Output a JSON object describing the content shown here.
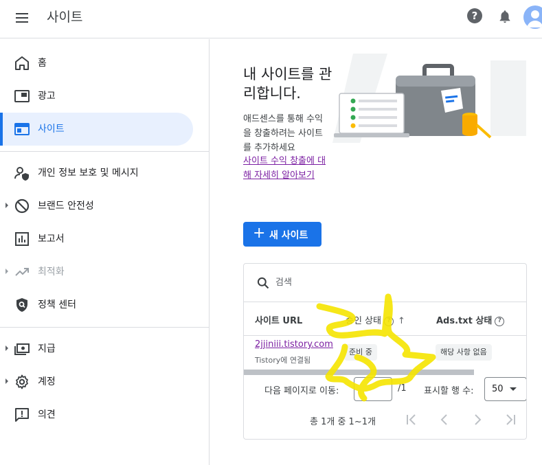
{
  "header": {
    "title": "사이트",
    "help_glyph": "?",
    "icons": [
      "menu-icon",
      "help-icon",
      "bell-icon",
      "avatar"
    ]
  },
  "sidebar": {
    "items": [
      {
        "label": "홈",
        "icon": "home-icon"
      },
      {
        "label": "광고",
        "icon": "ads-icon"
      },
      {
        "label": "사이트",
        "icon": "sites-icon",
        "active": true
      },
      {
        "label": "개인 정보 보호 및 메시지",
        "icon": "privacy-icon"
      },
      {
        "label": "브랜드 안전성",
        "icon": "block-icon",
        "expandable": true
      },
      {
        "label": "보고서",
        "icon": "reports-icon"
      },
      {
        "label": "최적화",
        "icon": "trending-icon",
        "expandable": true,
        "disabled": true
      },
      {
        "label": "정책 센터",
        "icon": "policy-shield-icon"
      },
      {
        "label": "지급",
        "icon": "payments-icon",
        "expandable": true
      },
      {
        "label": "계정",
        "icon": "gear-icon",
        "expandable": true
      },
      {
        "label": "의견",
        "icon": "feedback-icon"
      }
    ]
  },
  "hero": {
    "title": "내 사이트를 관리합니다.",
    "description": "애드센스를 통해 수익을 창출하려는 사이트를 추가하세요",
    "link": "사이트 수익 창출에 대해 자세히 알아보기"
  },
  "actions": {
    "new_site_plus": "+",
    "new_site_label": "새 사이트"
  },
  "table": {
    "search_placeholder": "검색",
    "columns": {
      "site_url": "사이트 URL",
      "approval_status": "승인 상태",
      "ads_txt_status": "Ads.txt 상태",
      "help_glyph": "?",
      "sort_glyph": "↑"
    },
    "rows": [
      {
        "url": "2jjiniii.tistory.com",
        "sub": "Tistory에 연결됨",
        "approval": "준비 중",
        "ads_txt": "해당 사항 없음"
      }
    ],
    "pagination": {
      "go_to_page_label": "다음 페이지로 이동:",
      "page_value": "",
      "page_total": "/1",
      "rows_per_page_label": "표시할 행 수:",
      "rows_per_page_value": "50",
      "count_text": "총 1개 중 1~1개"
    }
  },
  "colors": {
    "accent": "#1a73e8",
    "active_bg": "#e8f0fe",
    "link_visited": "#7b1fa2",
    "annotation_yellow": "#f5e400"
  }
}
